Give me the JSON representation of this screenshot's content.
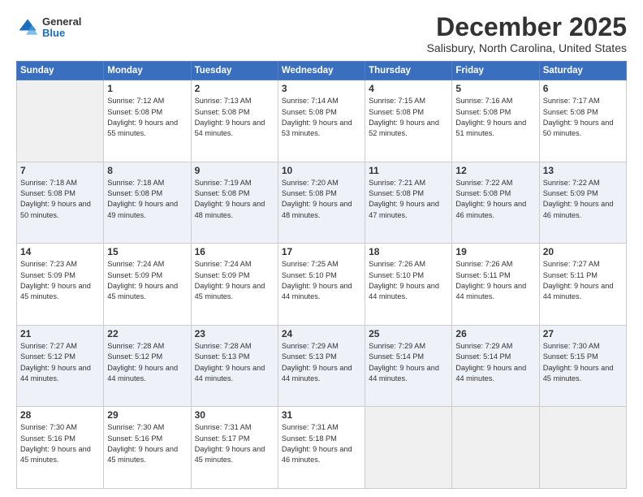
{
  "header": {
    "logo_general": "General",
    "logo_blue": "Blue",
    "title": "December 2025",
    "subtitle": "Salisbury, North Carolina, United States"
  },
  "days_header": [
    "Sunday",
    "Monday",
    "Tuesday",
    "Wednesday",
    "Thursday",
    "Friday",
    "Saturday"
  ],
  "weeks": [
    [
      {
        "day": "",
        "empty": true
      },
      {
        "day": "1",
        "sunrise": "7:12 AM",
        "sunset": "5:08 PM",
        "daylight": "9 hours and 55 minutes."
      },
      {
        "day": "2",
        "sunrise": "7:13 AM",
        "sunset": "5:08 PM",
        "daylight": "9 hours and 54 minutes."
      },
      {
        "day": "3",
        "sunrise": "7:14 AM",
        "sunset": "5:08 PM",
        "daylight": "9 hours and 53 minutes."
      },
      {
        "day": "4",
        "sunrise": "7:15 AM",
        "sunset": "5:08 PM",
        "daylight": "9 hours and 52 minutes."
      },
      {
        "day": "5",
        "sunrise": "7:16 AM",
        "sunset": "5:08 PM",
        "daylight": "9 hours and 51 minutes."
      },
      {
        "day": "6",
        "sunrise": "7:17 AM",
        "sunset": "5:08 PM",
        "daylight": "9 hours and 50 minutes."
      }
    ],
    [
      {
        "day": "7",
        "sunrise": "7:18 AM",
        "sunset": "5:08 PM",
        "daylight": "9 hours and 50 minutes."
      },
      {
        "day": "8",
        "sunrise": "7:18 AM",
        "sunset": "5:08 PM",
        "daylight": "9 hours and 49 minutes."
      },
      {
        "day": "9",
        "sunrise": "7:19 AM",
        "sunset": "5:08 PM",
        "daylight": "9 hours and 48 minutes."
      },
      {
        "day": "10",
        "sunrise": "7:20 AM",
        "sunset": "5:08 PM",
        "daylight": "9 hours and 48 minutes."
      },
      {
        "day": "11",
        "sunrise": "7:21 AM",
        "sunset": "5:08 PM",
        "daylight": "9 hours and 47 minutes."
      },
      {
        "day": "12",
        "sunrise": "7:22 AM",
        "sunset": "5:08 PM",
        "daylight": "9 hours and 46 minutes."
      },
      {
        "day": "13",
        "sunrise": "7:22 AM",
        "sunset": "5:09 PM",
        "daylight": "9 hours and 46 minutes."
      }
    ],
    [
      {
        "day": "14",
        "sunrise": "7:23 AM",
        "sunset": "5:09 PM",
        "daylight": "9 hours and 45 minutes."
      },
      {
        "day": "15",
        "sunrise": "7:24 AM",
        "sunset": "5:09 PM",
        "daylight": "9 hours and 45 minutes."
      },
      {
        "day": "16",
        "sunrise": "7:24 AM",
        "sunset": "5:09 PM",
        "daylight": "9 hours and 45 minutes."
      },
      {
        "day": "17",
        "sunrise": "7:25 AM",
        "sunset": "5:10 PM",
        "daylight": "9 hours and 44 minutes."
      },
      {
        "day": "18",
        "sunrise": "7:26 AM",
        "sunset": "5:10 PM",
        "daylight": "9 hours and 44 minutes."
      },
      {
        "day": "19",
        "sunrise": "7:26 AM",
        "sunset": "5:11 PM",
        "daylight": "9 hours and 44 minutes."
      },
      {
        "day": "20",
        "sunrise": "7:27 AM",
        "sunset": "5:11 PM",
        "daylight": "9 hours and 44 minutes."
      }
    ],
    [
      {
        "day": "21",
        "sunrise": "7:27 AM",
        "sunset": "5:12 PM",
        "daylight": "9 hours and 44 minutes."
      },
      {
        "day": "22",
        "sunrise": "7:28 AM",
        "sunset": "5:12 PM",
        "daylight": "9 hours and 44 minutes."
      },
      {
        "day": "23",
        "sunrise": "7:28 AM",
        "sunset": "5:13 PM",
        "daylight": "9 hours and 44 minutes."
      },
      {
        "day": "24",
        "sunrise": "7:29 AM",
        "sunset": "5:13 PM",
        "daylight": "9 hours and 44 minutes."
      },
      {
        "day": "25",
        "sunrise": "7:29 AM",
        "sunset": "5:14 PM",
        "daylight": "9 hours and 44 minutes."
      },
      {
        "day": "26",
        "sunrise": "7:29 AM",
        "sunset": "5:14 PM",
        "daylight": "9 hours and 44 minutes."
      },
      {
        "day": "27",
        "sunrise": "7:30 AM",
        "sunset": "5:15 PM",
        "daylight": "9 hours and 45 minutes."
      }
    ],
    [
      {
        "day": "28",
        "sunrise": "7:30 AM",
        "sunset": "5:16 PM",
        "daylight": "9 hours and 45 minutes."
      },
      {
        "day": "29",
        "sunrise": "7:30 AM",
        "sunset": "5:16 PM",
        "daylight": "9 hours and 45 minutes."
      },
      {
        "day": "30",
        "sunrise": "7:31 AM",
        "sunset": "5:17 PM",
        "daylight": "9 hours and 45 minutes."
      },
      {
        "day": "31",
        "sunrise": "7:31 AM",
        "sunset": "5:18 PM",
        "daylight": "9 hours and 46 minutes."
      },
      {
        "day": "",
        "empty": true
      },
      {
        "day": "",
        "empty": true
      },
      {
        "day": "",
        "empty": true
      }
    ]
  ],
  "labels": {
    "sunrise": "Sunrise:",
    "sunset": "Sunset:",
    "daylight": "Daylight:"
  }
}
